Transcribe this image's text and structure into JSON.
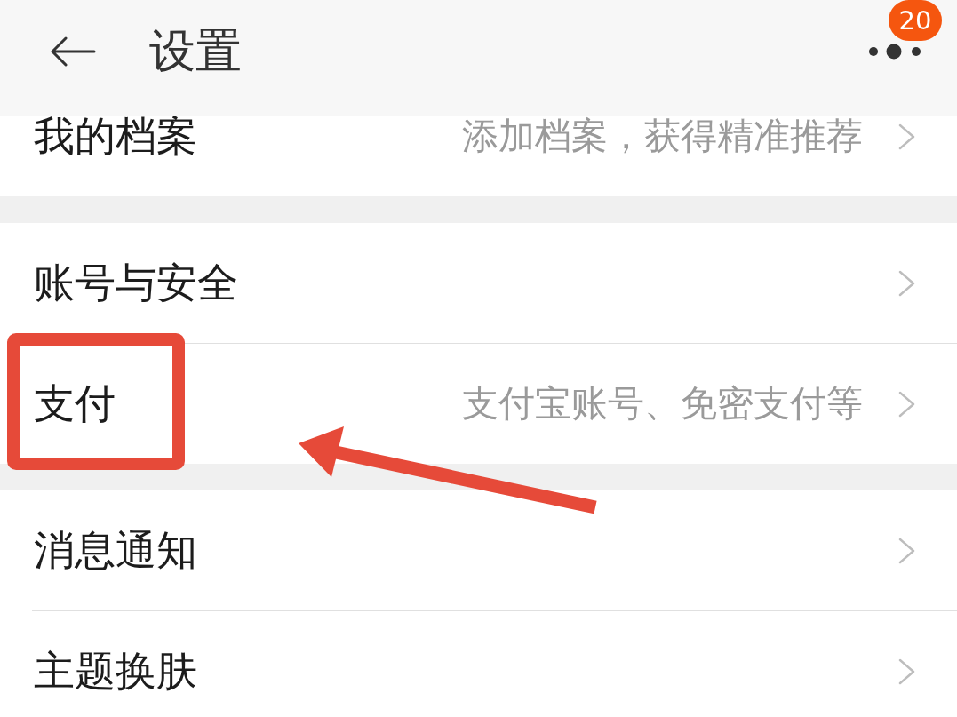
{
  "header": {
    "title": "设置",
    "badge": "20"
  },
  "sections": [
    {
      "items": [
        {
          "label": "我的档案",
          "hint": "添加档案，获得精准推荐",
          "highlighted": false
        }
      ]
    },
    {
      "items": [
        {
          "label": "账号与安全",
          "highlighted": false
        },
        {
          "label": "支付",
          "hint": "支付宝账号、免密支付等",
          "highlighted": true
        }
      ]
    },
    {
      "items": [
        {
          "label": "消息通知",
          "highlighted": false
        },
        {
          "label": "主题换肤",
          "highlighted": false
        }
      ]
    }
  ]
}
